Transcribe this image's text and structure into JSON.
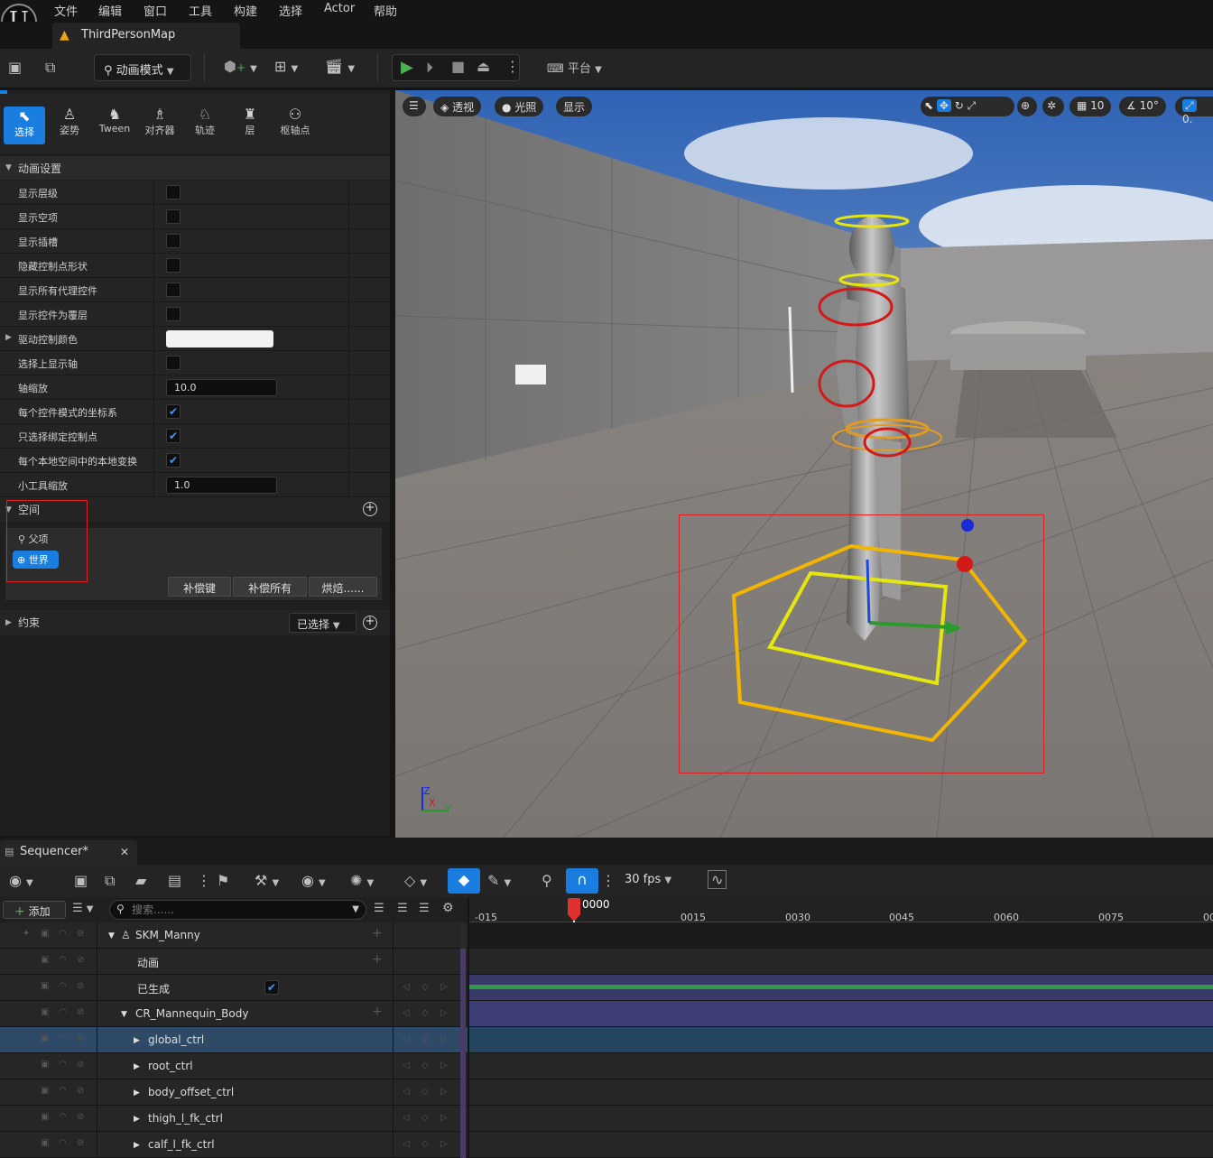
{
  "menu": [
    "文件",
    "编辑",
    "窗口",
    "工具",
    "构建",
    "选择",
    "Actor",
    "帮助"
  ],
  "map_tab": {
    "label": "ThirdPersonMap"
  },
  "toolbar": {
    "mode_label": "动画模式",
    "platform_label": "平台"
  },
  "modes": [
    {
      "label": "选择",
      "active": true
    },
    {
      "label": "姿势"
    },
    {
      "label": "Tween"
    },
    {
      "label": "对齐器"
    },
    {
      "label": "轨迹"
    },
    {
      "label": "层"
    },
    {
      "label": "枢轴点"
    }
  ],
  "anim_settings": {
    "header": "动画设置",
    "rows": [
      {
        "label": "显示层级",
        "type": "check",
        "checked": false
      },
      {
        "label": "显示空项",
        "type": "check",
        "checked": false
      },
      {
        "label": "显示插槽",
        "type": "check",
        "checked": false
      },
      {
        "label": "隐藏控制点形状",
        "type": "check",
        "checked": false
      },
      {
        "label": "显示所有代理控件",
        "type": "check",
        "checked": false
      },
      {
        "label": "显示控件为覆层",
        "type": "check",
        "checked": false
      },
      {
        "label": "驱动控制颜色",
        "type": "color",
        "color": "#f2f2f2"
      },
      {
        "label": "选择上显示轴",
        "type": "check",
        "checked": false
      },
      {
        "label": "轴缩放",
        "type": "num",
        "value": "10.0"
      },
      {
        "label": "每个控件模式的坐标系",
        "type": "check",
        "checked": true
      },
      {
        "label": "只选择绑定控制点",
        "type": "check",
        "checked": true
      },
      {
        "label": "每个本地空间中的本地变换",
        "type": "check",
        "checked": true
      },
      {
        "label": "小工具缩放",
        "type": "num",
        "value": "1.0"
      }
    ]
  },
  "space": {
    "header": "空间",
    "parent_label": "父项",
    "world_label": "世界",
    "buttons": [
      "补偿键",
      "补偿所有",
      "烘焙......"
    ]
  },
  "constraints": {
    "header": "约束",
    "filter": "已选择"
  },
  "viewport": {
    "perspective": "透视",
    "lighting": "光照",
    "show": "显示",
    "grid": "10",
    "angle": "10°",
    "scale": "0."
  },
  "sequencer": {
    "tab": "Sequencer*",
    "add_label": "添加",
    "search_placeholder": "搜索......",
    "fps": "30 fps",
    "current_frame": "0000",
    "ticks": [
      "-015",
      "0015",
      "0030",
      "0045",
      "0060",
      "0075",
      "00"
    ],
    "tracks": [
      {
        "name": "SKM_Manny",
        "indent": 0,
        "expand": "open"
      },
      {
        "name": "动画",
        "indent": 1
      },
      {
        "name": "已生成",
        "indent": 1,
        "check": true
      },
      {
        "name": "CR_Mannequin_Body",
        "indent": 1,
        "expand": "open"
      },
      {
        "name": "global_ctrl",
        "indent": 2,
        "expand": "closed",
        "selected": true
      },
      {
        "name": "root_ctrl",
        "indent": 2,
        "expand": "closed"
      },
      {
        "name": "body_offset_ctrl",
        "indent": 2,
        "expand": "closed"
      },
      {
        "name": "thigh_l_fk_ctrl",
        "indent": 2,
        "expand": "closed"
      },
      {
        "name": "calf_l_fk_ctrl",
        "indent": 2,
        "expand": "closed"
      }
    ]
  },
  "colors": {
    "accent": "#1a7de0",
    "play": "#4caf50",
    "highlight_box": "#e02020"
  }
}
